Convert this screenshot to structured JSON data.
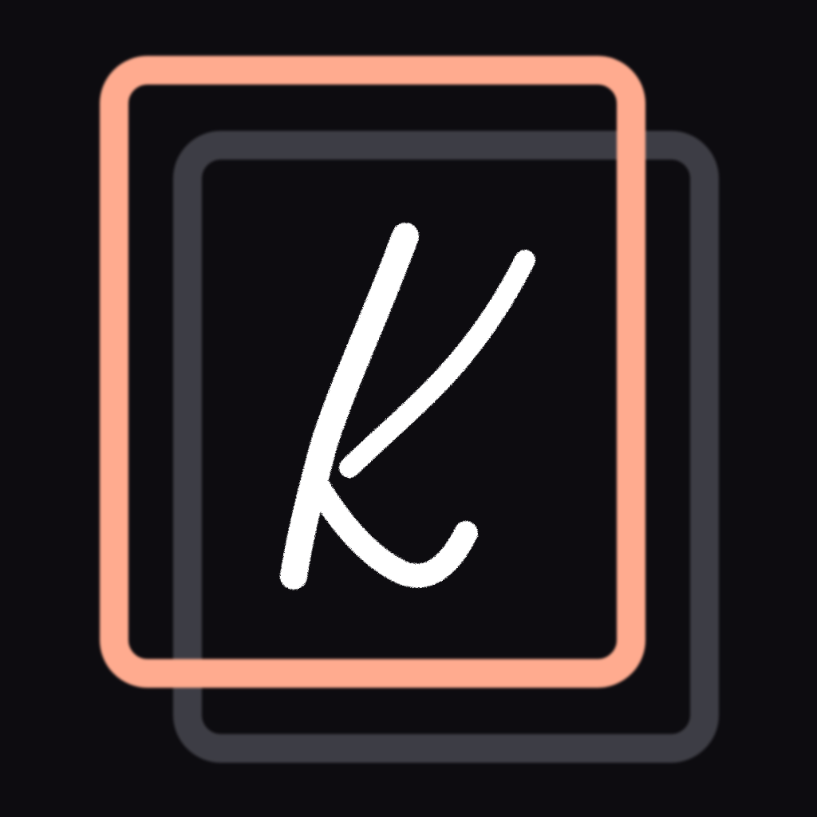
{
  "logo": {
    "name": "k-app-icon",
    "letter": "k",
    "colors": {
      "background": "#0d0c10",
      "front_frame": "#ffab8f",
      "back_frame": "#3d3c44",
      "letter": "#ffffff"
    }
  }
}
